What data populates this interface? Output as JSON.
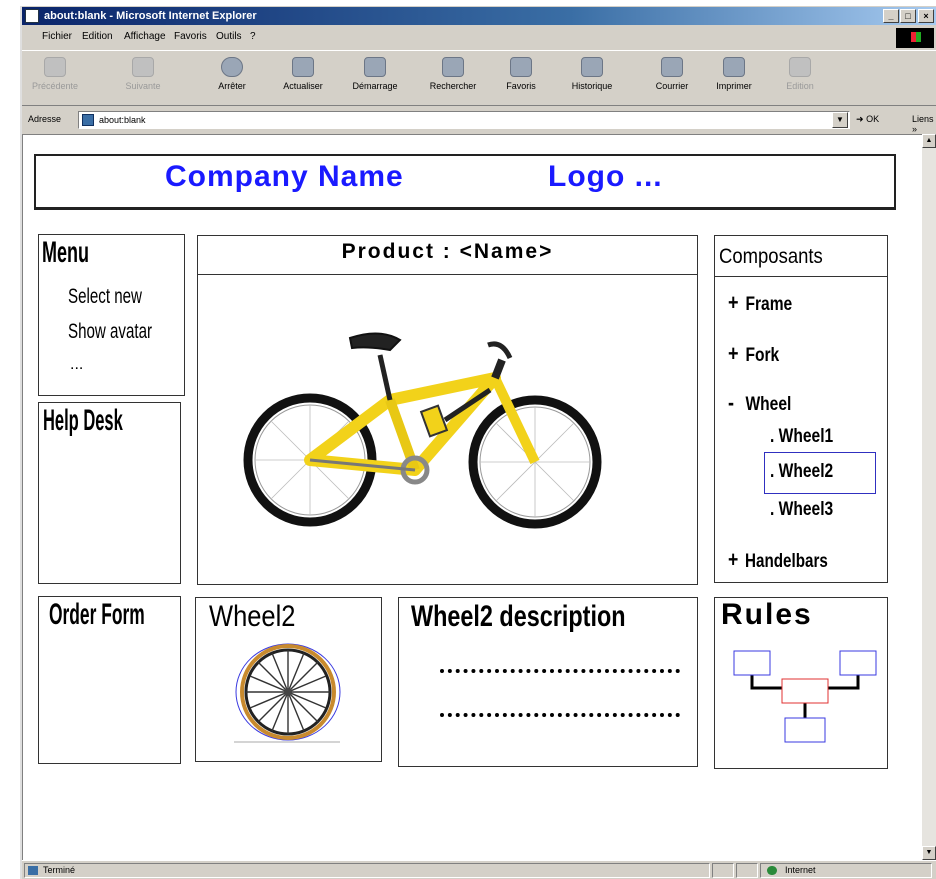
{
  "window": {
    "title": "about:blank - Microsoft Internet Explorer",
    "controls": [
      "_",
      "□",
      "×"
    ]
  },
  "menu": [
    "Fichier",
    "Edition",
    "Affichage",
    "Favoris",
    "Outils",
    "?"
  ],
  "toolbar": [
    {
      "label": "Précédente",
      "icon": "back-arrow-icon",
      "enabled": false
    },
    {
      "label": "Suivante",
      "icon": "forward-arrow-icon",
      "enabled": false
    },
    {
      "label": "Arrêter",
      "icon": "stop-icon",
      "enabled": true
    },
    {
      "label": "Actualiser",
      "icon": "refresh-icon",
      "enabled": true
    },
    {
      "label": "Démarrage",
      "icon": "home-icon",
      "enabled": true
    },
    {
      "label": "Rechercher",
      "icon": "search-icon",
      "enabled": true
    },
    {
      "label": "Favoris",
      "icon": "favorites-icon",
      "enabled": true
    },
    {
      "label": "Historique",
      "icon": "history-icon",
      "enabled": true
    },
    {
      "label": "Courrier",
      "icon": "mail-icon",
      "enabled": true
    },
    {
      "label": "Imprimer",
      "icon": "print-icon",
      "enabled": true
    },
    {
      "label": "Edition",
      "icon": "edit-icon",
      "enabled": false
    }
  ],
  "address": {
    "label": "Adresse",
    "value": "about:blank",
    "go": "OK",
    "links": "Liens »"
  },
  "status": {
    "left": "Terminé",
    "zone": "Internet"
  },
  "mockup": {
    "company": "Company Name",
    "logo": "Logo ...",
    "menu_title": "Menu",
    "menu_items": [
      "Select new",
      "Show avatar",
      "..."
    ],
    "help_desk": "Help Desk",
    "order_form": "Order Form",
    "product_title": "Product : <Name>",
    "composants_title": "Composants",
    "composants": [
      {
        "sign": "+",
        "label": "Frame"
      },
      {
        "sign": "+",
        "label": "Fork"
      },
      {
        "sign": "-",
        "label": "Wheel"
      }
    ],
    "wheel_children": [
      ". Wheel1",
      ". Wheel2",
      ". Wheel3"
    ],
    "selected_child": ". Wheel2",
    "handlebars": {
      "sign": "+",
      "label": "Handelbars"
    },
    "wheel_panel_title": "Wheel2",
    "description_title": "Wheel2 description",
    "rules_title": "Rules"
  },
  "colors": {
    "accent_blue": "#1a1aff",
    "rule_box_border": "#3a3ae0",
    "rule_center_border": "#e03030",
    "bike_frame": "#f2d21a"
  }
}
